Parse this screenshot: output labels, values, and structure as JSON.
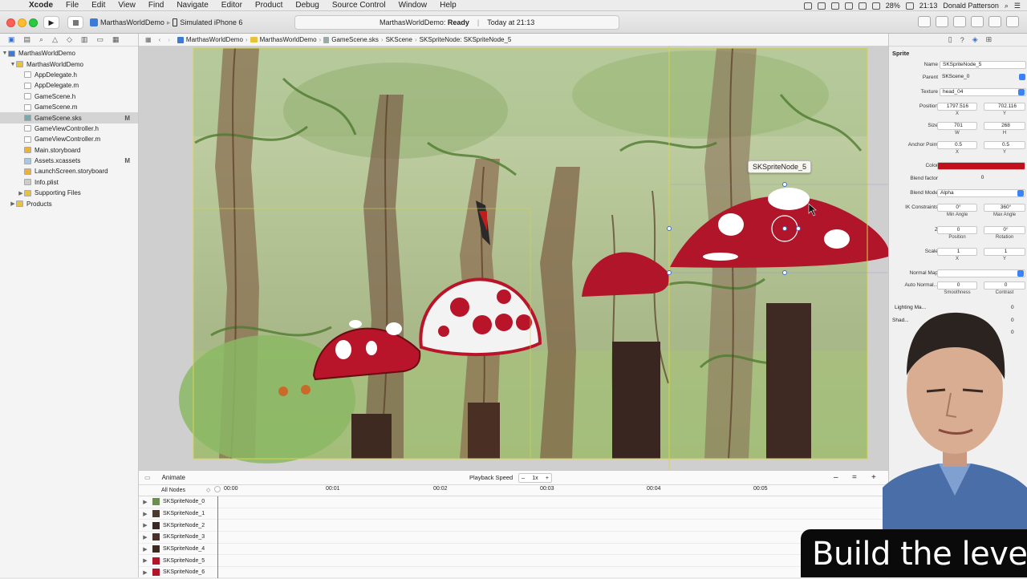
{
  "menubar": {
    "app": "Xcode",
    "items": [
      "File",
      "Edit",
      "View",
      "Find",
      "Navigate",
      "Editor",
      "Product",
      "Debug",
      "Source Control",
      "Window",
      "Help"
    ],
    "battery": "28%",
    "time": "21:13",
    "user": "Donald Patterson"
  },
  "toolbar": {
    "scheme": "MarthasWorldDemo",
    "device": "Simulated iPhone 6",
    "status_project": "MarthasWorldDemo:",
    "status_state": "Ready",
    "status_time": "Today at 21:13"
  },
  "navigator": {
    "rows": [
      {
        "label": "MarthasWorldDemo",
        "level": 0,
        "disclosure": "▼",
        "icon": "project",
        "badge": ""
      },
      {
        "label": "MarthasWorldDemo",
        "level": 1,
        "disclosure": "▼",
        "icon": "folder",
        "badge": ""
      },
      {
        "label": "AppDelegate.h",
        "level": 2,
        "disclosure": "",
        "icon": "h",
        "badge": ""
      },
      {
        "label": "AppDelegate.m",
        "level": 2,
        "disclosure": "",
        "icon": "m",
        "badge": ""
      },
      {
        "label": "GameScene.h",
        "level": 2,
        "disclosure": "",
        "icon": "h",
        "badge": ""
      },
      {
        "label": "GameScene.m",
        "level": 2,
        "disclosure": "",
        "icon": "m",
        "badge": ""
      },
      {
        "label": "GameScene.sks",
        "level": 2,
        "disclosure": "",
        "icon": "sks",
        "badge": "M",
        "selected": true
      },
      {
        "label": "GameViewController.h",
        "level": 2,
        "disclosure": "",
        "icon": "h",
        "badge": ""
      },
      {
        "label": "GameViewController.m",
        "level": 2,
        "disclosure": "",
        "icon": "m",
        "badge": ""
      },
      {
        "label": "Main.storyboard",
        "level": 2,
        "disclosure": "",
        "icon": "storyboard",
        "badge": ""
      },
      {
        "label": "Assets.xcassets",
        "level": 2,
        "disclosure": "",
        "icon": "assets",
        "badge": "M"
      },
      {
        "label": "LaunchScreen.storyboard",
        "level": 2,
        "disclosure": "",
        "icon": "storyboard",
        "badge": ""
      },
      {
        "label": "Info.plist",
        "level": 2,
        "disclosure": "",
        "icon": "plist",
        "badge": ""
      },
      {
        "label": "Supporting Files",
        "level": 2,
        "disclosure": "▶",
        "icon": "folder",
        "badge": ""
      },
      {
        "label": "Products",
        "level": 1,
        "disclosure": "▶",
        "icon": "folder",
        "badge": ""
      }
    ]
  },
  "jumpbar": {
    "crumbs": [
      "MarthasWorldDemo",
      "MarthasWorldDemo",
      "GameScene.sks",
      "SKScene",
      "SKSpriteNode: SKSpriteNode_5"
    ]
  },
  "scene": {
    "tooltip": "SKSpriteNode_5"
  },
  "timeline": {
    "animate": "Animate",
    "playback_label": "Playback Speed",
    "playback_value": "1x",
    "all_nodes": "All Nodes",
    "ticks": [
      "00:00",
      "00:01",
      "00:02",
      "00:03",
      "00:04",
      "00:05"
    ],
    "rows": [
      {
        "name": "SKSpriteNode_0",
        "thumb": "#6b8f4e"
      },
      {
        "name": "SKSpriteNode_1",
        "thumb": "#4a3a30"
      },
      {
        "name": "SKSpriteNode_2",
        "thumb": "#3a2a22"
      },
      {
        "name": "SKSpriteNode_3",
        "thumb": "#4a3026"
      },
      {
        "name": "SKSpriteNode_4",
        "thumb": "#3a2a22"
      },
      {
        "name": "SKSpriteNode_5",
        "thumb": "#b0152a"
      },
      {
        "name": "SKSpriteNode_6",
        "thumb": "#b0152a"
      }
    ]
  },
  "inspector": {
    "section": "Sprite",
    "name_label": "Name",
    "name_value": "SKSpriteNode_5",
    "parent_label": "Parent",
    "parent_value": "SKScene_0",
    "texture_label": "Texture",
    "texture_value": "head_04",
    "position_label": "Position",
    "position_x": "1797.516",
    "position_y": "702.116",
    "x": "X",
    "y": "Y",
    "size_label": "Size",
    "size_w": "701",
    "size_h": "268",
    "w": "W",
    "h": "H",
    "anchor_label": "Anchor Point",
    "anchor_x": "0.5",
    "anchor_y": "0.5",
    "color_label": "Color",
    "color_value": "#c0101c",
    "blend_factor_label": "Blend factor",
    "blend_factor_value": "0",
    "blend_mode_label": "Blend Mode",
    "blend_mode_value": "Alpha",
    "ik_label": "IK Constraints",
    "ik_min": "0°",
    "ik_max": "360°",
    "min_angle": "Min Angle",
    "max_angle": "Max Angle",
    "z_label": "Z",
    "z_position": "0",
    "z_rotation": "0°",
    "position_sub": "Position",
    "rotation_sub": "Rotation",
    "scale_label": "Scale",
    "scale_x": "1",
    "scale_y": "1",
    "normal_map_label": "Normal Map",
    "normal_map_value": "",
    "auto_normal_label": "Auto Normal...",
    "smoothness": "0",
    "contrast": "0",
    "smoothness_sub": "Smoothness",
    "contrast_sub": "Contrast",
    "lighting_label": "Lighting Ma...",
    "lighting_value": "0",
    "shadow_label": "Shad...",
    "shadow_value": "0",
    "third_value": "0"
  },
  "overlay": {
    "caption": "Build the level"
  }
}
